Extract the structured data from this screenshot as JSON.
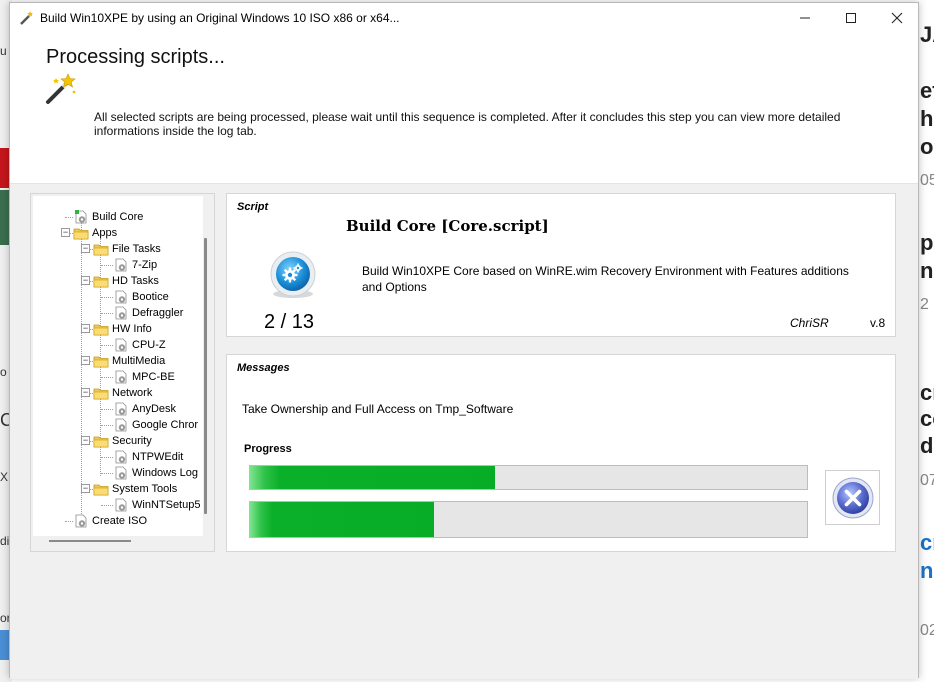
{
  "window": {
    "title": "Build Win10XPE by using an Original Windows 10 ISO x86 or x64...",
    "controls": {
      "minimize": "—",
      "maximize": "☐",
      "close": "✕"
    }
  },
  "header": {
    "title": "Processing scripts...",
    "description": "All selected scripts are being processed, please wait until this sequence is completed. After it concludes this step you can view more detailed informations inside the log tab."
  },
  "tree": {
    "items": [
      {
        "label": "Build Core",
        "type": "script",
        "level": 0
      },
      {
        "label": "Apps",
        "type": "folder",
        "level": 0
      },
      {
        "label": "File Tasks",
        "type": "folder",
        "level": 1
      },
      {
        "label": "7-Zip",
        "type": "script",
        "level": 2
      },
      {
        "label": "HD Tasks",
        "type": "folder",
        "level": 1
      },
      {
        "label": "Bootice",
        "type": "script",
        "level": 2
      },
      {
        "label": "Defraggler",
        "type": "script",
        "level": 2
      },
      {
        "label": "HW Info",
        "type": "folder",
        "level": 1
      },
      {
        "label": "CPU-Z",
        "type": "script",
        "level": 2
      },
      {
        "label": "MultiMedia",
        "type": "folder",
        "level": 1
      },
      {
        "label": "MPC-BE",
        "type": "script",
        "level": 2
      },
      {
        "label": "Network",
        "type": "folder",
        "level": 1
      },
      {
        "label": "AnyDesk",
        "type": "script",
        "level": 2
      },
      {
        "label": "Google Chror",
        "type": "script",
        "level": 2
      },
      {
        "label": "Security",
        "type": "folder",
        "level": 1
      },
      {
        "label": "NTPWEdit",
        "type": "script",
        "level": 2
      },
      {
        "label": "Windows Log",
        "type": "script",
        "level": 2
      },
      {
        "label": "System Tools",
        "type": "folder",
        "level": 1
      },
      {
        "label": "WinNTSetup5",
        "type": "script",
        "level": 2
      },
      {
        "label": "Create ISO",
        "type": "script",
        "level": 0
      }
    ]
  },
  "script": {
    "section_label": "Script",
    "title": "Build Core [Core.script]",
    "description": "Build Win10XPE Core based on WinRE.wim Recovery Environment with Features additions and Options",
    "counter": "2 / 13",
    "author": "ChriSR",
    "version": "v.8"
  },
  "messages": {
    "section_label": "Messages",
    "text": "Take Ownership and Full Access on Tmp_Software",
    "progress_label": "Progress",
    "progress_script": 0.44,
    "progress_total": 0.33
  },
  "colors": {
    "progress_green": "#07ad27",
    "panel_bg": "#f0f0f0",
    "cancel_blue": "#5b6fd0"
  },
  "icons": {
    "title": "magic-wand-icon",
    "header": "magic-wand-icon",
    "script": "gear-globe-icon",
    "cancel": "cancel-x-icon",
    "folder": "folder-icon",
    "script_node": "script-gear-icon"
  },
  "background": {
    "right_fragments": [
      "JA",
      "eta",
      "h",
      "o",
      "05",
      "p",
      "ng",
      "2",
      "cr",
      "co",
      "d",
      "07",
      "cr",
      "n",
      "02"
    ],
    "left_fragments": [
      "u",
      "o",
      "Co",
      "X",
      "di",
      "or",
      "Ø"
    ]
  }
}
